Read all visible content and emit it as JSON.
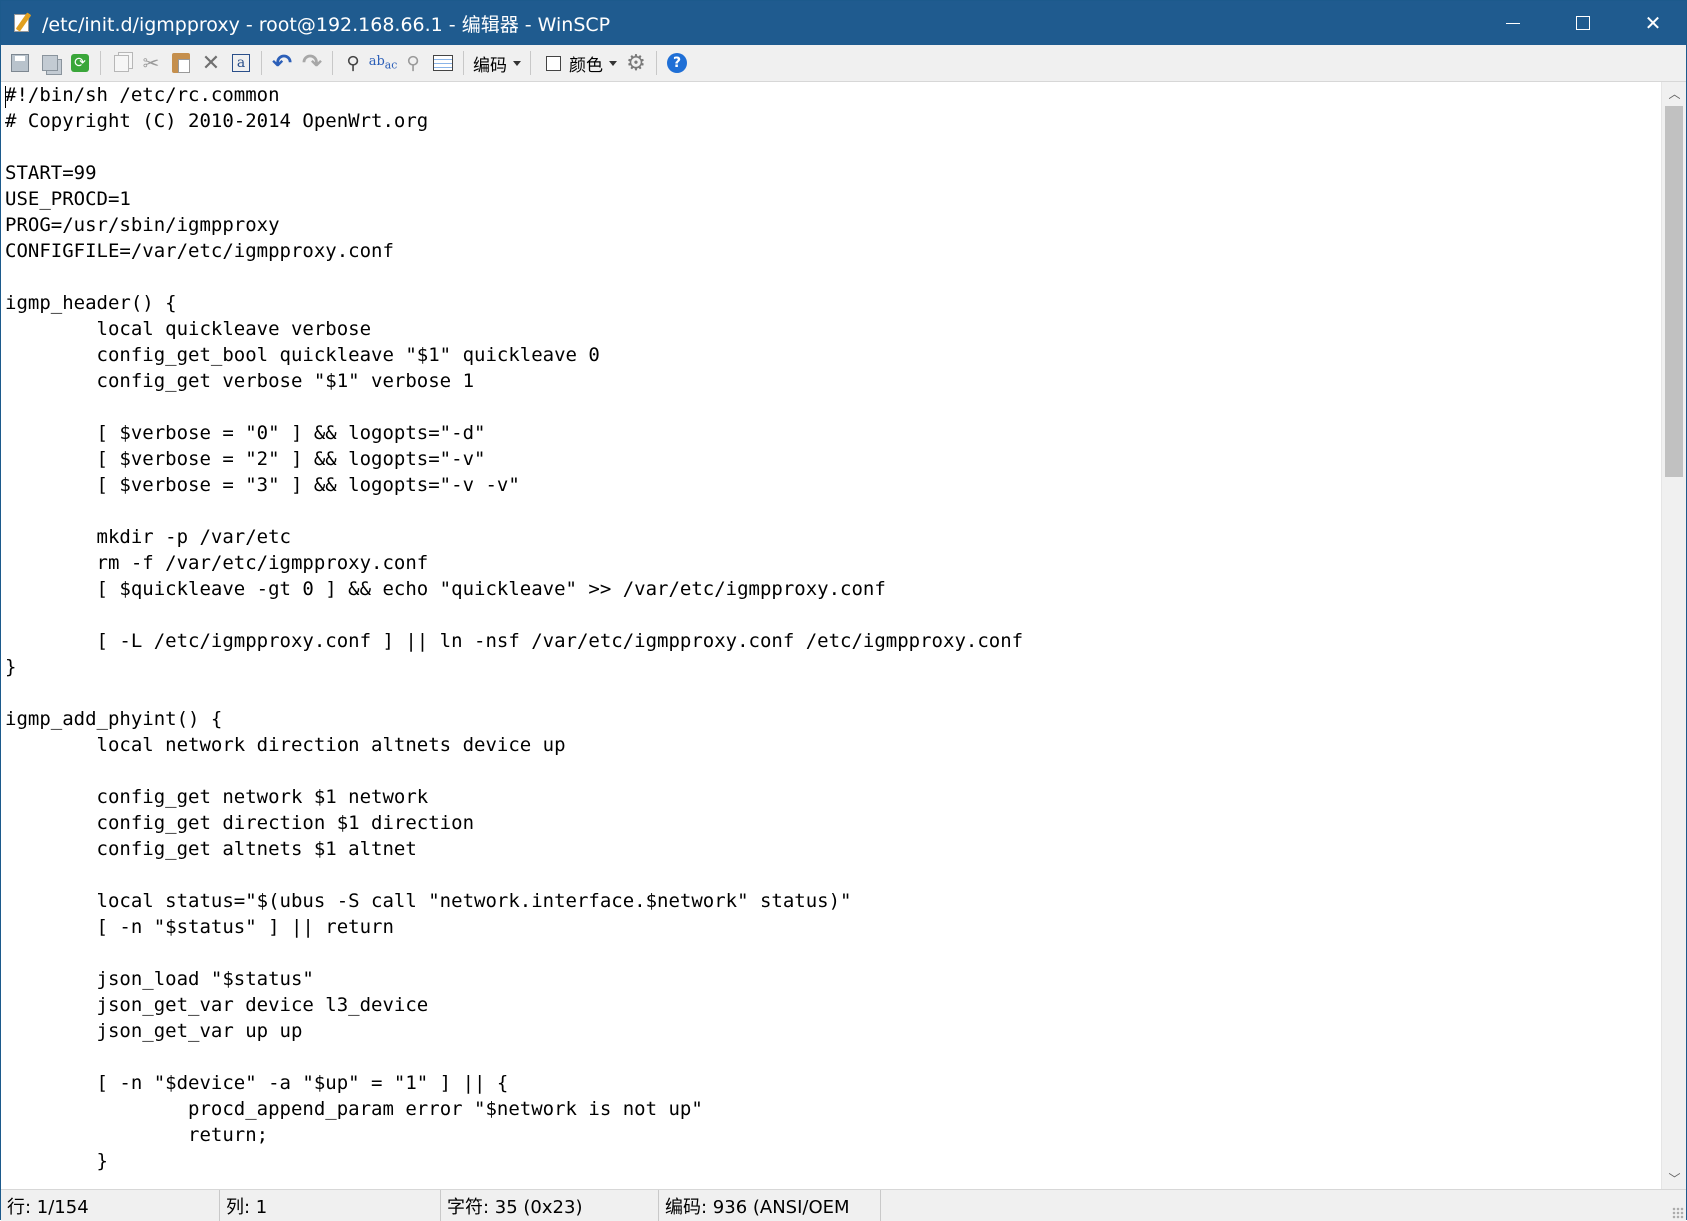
{
  "window": {
    "title": "/etc/init.d/igmpproxy - root@192.168.66.1 - 编辑器 - WinSCP",
    "controls": {
      "minimize": "minimize",
      "maximize": "maximize",
      "close": "✕"
    }
  },
  "toolbar": {
    "encoding_label": "编码",
    "color_label": "颜色",
    "icons": [
      "save-icon",
      "save-all-icon",
      "reload-icon",
      "copy-icon",
      "cut-icon",
      "paste-icon",
      "delete-icon",
      "select-all-icon",
      "undo-icon",
      "redo-icon",
      "find-icon",
      "replace-icon",
      "find-next-icon",
      "go-to-line-icon",
      "preferences-gear-icon",
      "help-icon"
    ]
  },
  "editor": {
    "lines": [
      "#!/bin/sh /etc/rc.common",
      "# Copyright (C) 2010-2014 OpenWrt.org",
      "",
      "START=99",
      "USE_PROCD=1",
      "PROG=/usr/sbin/igmpproxy",
      "CONFIGFILE=/var/etc/igmpproxy.conf",
      "",
      "igmp_header() {",
      "\tlocal quickleave verbose",
      "\tconfig_get_bool quickleave \"$1\" quickleave 0",
      "\tconfig_get verbose \"$1\" verbose 1",
      "",
      "\t[ $verbose = \"0\" ] && logopts=\"-d\"",
      "\t[ $verbose = \"2\" ] && logopts=\"-v\"",
      "\t[ $verbose = \"3\" ] && logopts=\"-v -v\"",
      "",
      "\tmkdir -p /var/etc",
      "\trm -f /var/etc/igmpproxy.conf",
      "\t[ $quickleave -gt 0 ] && echo \"quickleave\" >> /var/etc/igmpproxy.conf",
      "",
      "\t[ -L /etc/igmpproxy.conf ] || ln -nsf /var/etc/igmpproxy.conf /etc/igmpproxy.conf",
      "}",
      "",
      "igmp_add_phyint() {",
      "\tlocal network direction altnets device up",
      "",
      "\tconfig_get network $1 network",
      "\tconfig_get direction $1 direction",
      "\tconfig_get altnets $1 altnet",
      "",
      "\tlocal status=\"$(ubus -S call \"network.interface.$network\" status)\"",
      "\t[ -n \"$status\" ] || return",
      "",
      "\tjson_load \"$status\"",
      "\tjson_get_var device l3_device",
      "\tjson_get_var up up",
      "",
      "\t[ -n \"$device\" -a \"$up\" = \"1\" ] || {",
      "\t\tprocd_append_param error \"$network is not up\"",
      "\t\treturn;",
      "\t}"
    ]
  },
  "statusbar": {
    "line": "行: 1/154",
    "column": "列: 1",
    "character": "字符: 35 (0x23)",
    "encoding": "编码: 936  (ANSI/OEM"
  }
}
